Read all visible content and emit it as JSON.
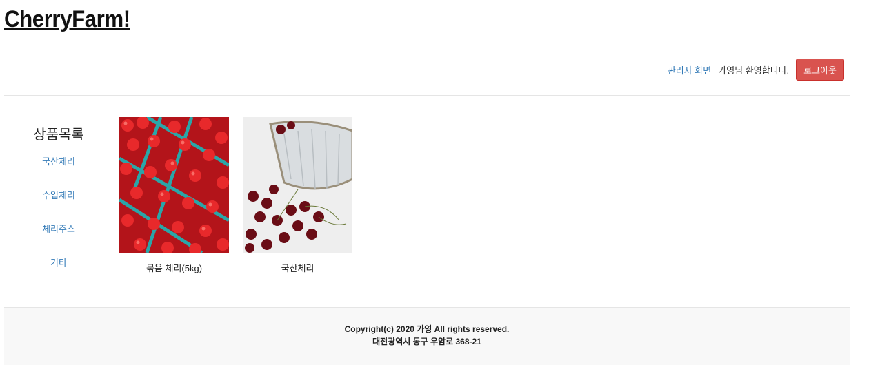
{
  "header": {
    "logo": "CherryFarm!"
  },
  "user_bar": {
    "admin_link": "관리자 화면",
    "welcome": "가영님 환영합니다.",
    "logout_label": "로그아웃"
  },
  "sidebar": {
    "title": "상품목록",
    "items": [
      {
        "label": "국산체리"
      },
      {
        "label": "수입체리"
      },
      {
        "label": "체리주스"
      },
      {
        "label": "기타"
      }
    ]
  },
  "products": [
    {
      "name": "묶음 체리(5kg)",
      "image": "cherries-in-blue-baskets"
    },
    {
      "name": "국산체리",
      "image": "cherries-with-glass-bowl"
    }
  ],
  "footer": {
    "copyright": "Copyright(c) 2020 가영 All rights reserved.",
    "address": "대전광역시 동구 우암로 368-21"
  },
  "colors": {
    "link": "#337ab7",
    "logout": "#d9534f",
    "footer_bg": "#f8f8f8"
  }
}
